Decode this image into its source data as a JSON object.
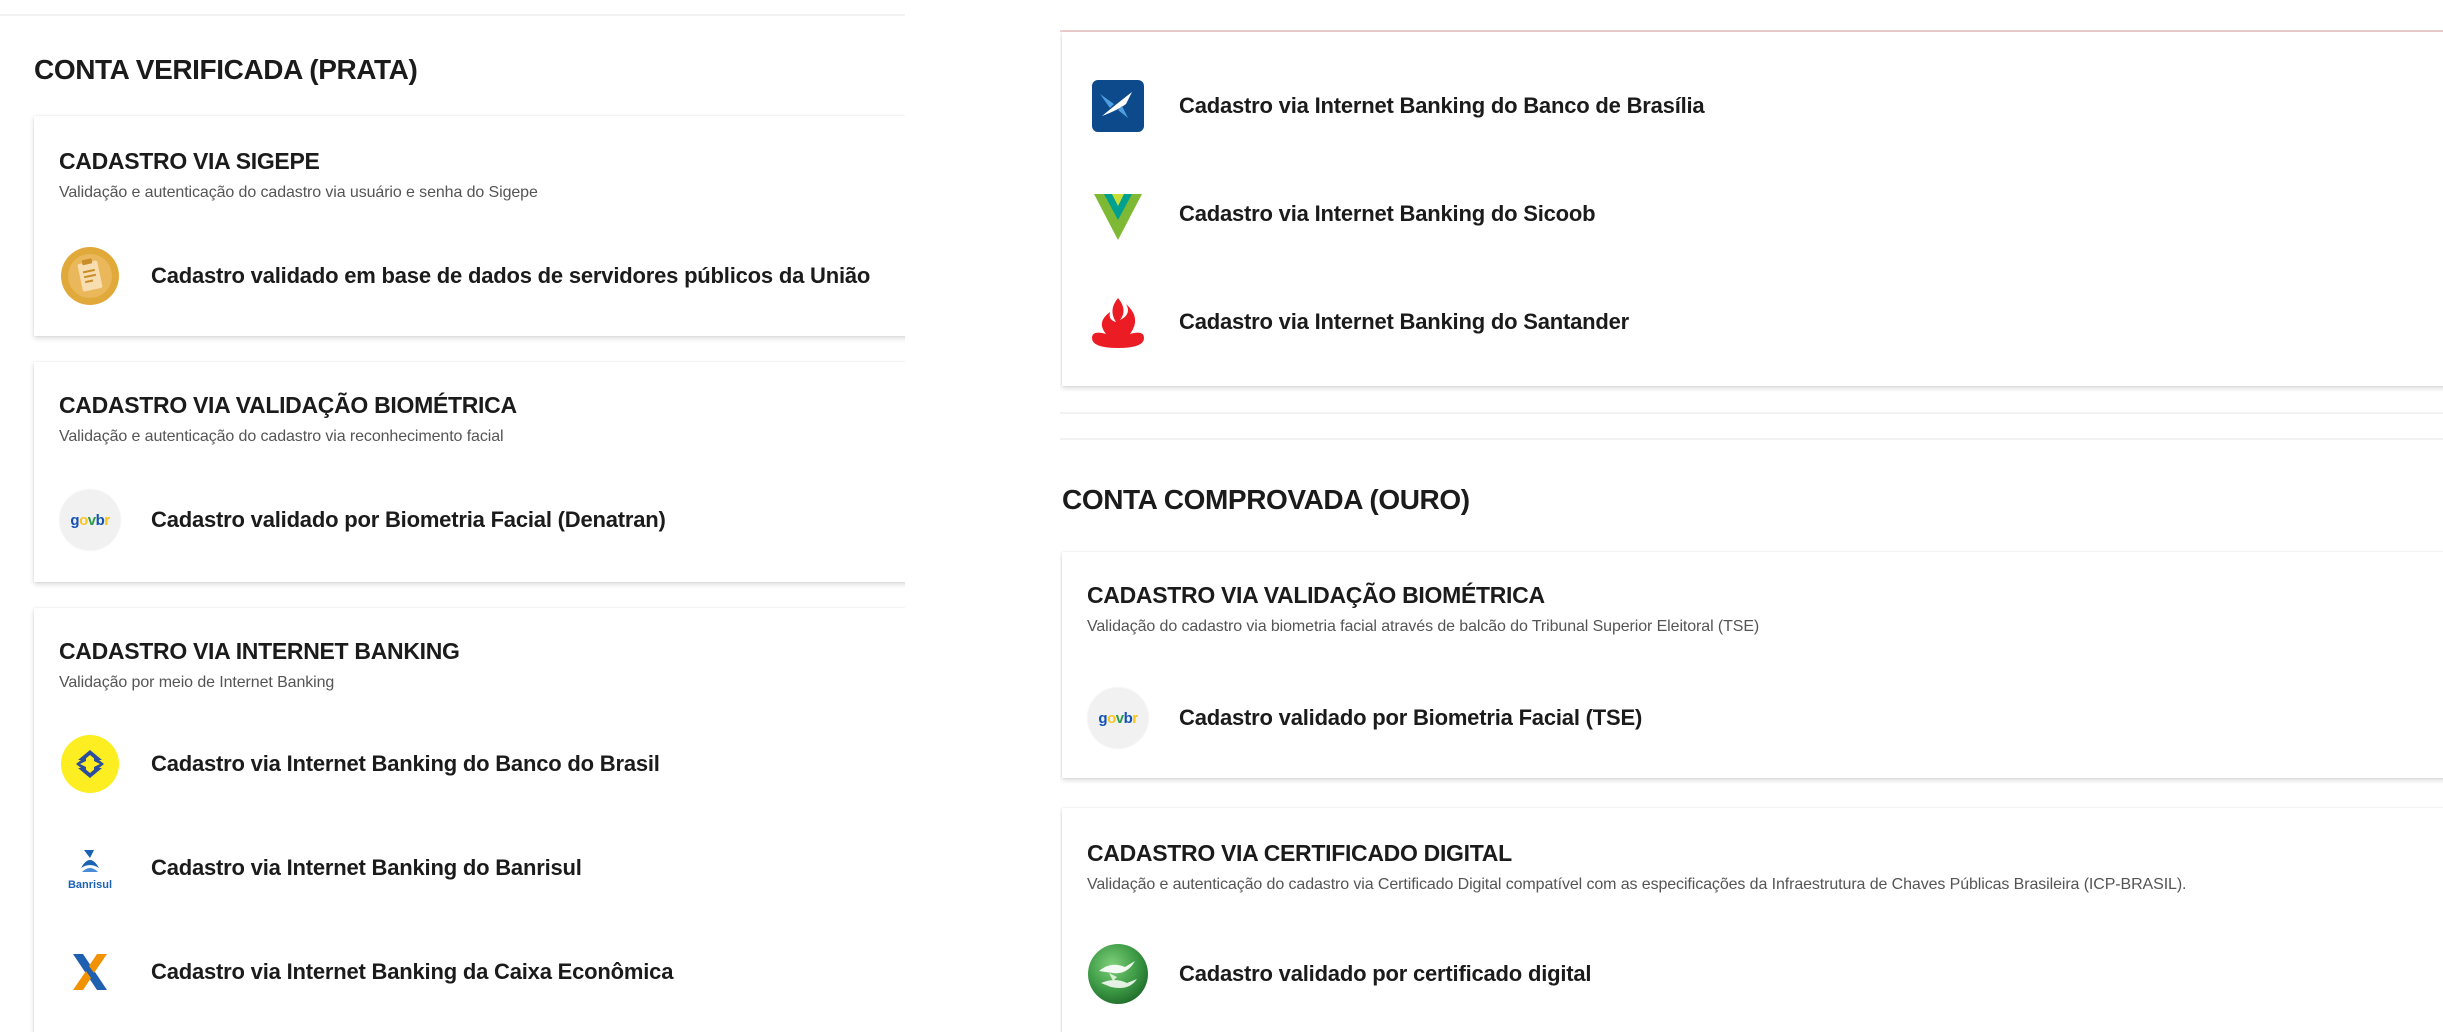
{
  "left": {
    "section_title": "CONTA VERIFICADA (PRATA)",
    "sigepe": {
      "title": "CADASTRO VIA SIGEPE",
      "description": "Validação e autenticação do cadastro via usuário e senha do Sigepe",
      "option": "Cadastro validado em base de dados de servidores públicos da União"
    },
    "biometria": {
      "title": "CADASTRO VIA VALIDAÇÃO BIOMÉTRICA",
      "description": "Validação e autenticação do cadastro via reconhecimento facial",
      "option": "Cadastro validado por Biometria Facial (Denatran)"
    },
    "internet_banking": {
      "title": "CADASTRO VIA INTERNET BANKING",
      "description": "Validação por meio de Internet Banking",
      "options": [
        "Cadastro via Internet Banking do Banco do Brasil",
        "Cadastro via Internet Banking do Banrisul",
        "Cadastro via Internet Banking da Caixa Econômica"
      ],
      "banrisul_logo_text": "Banrisul"
    }
  },
  "right": {
    "banking_options": [
      "Cadastro via Internet Banking do Banco de Brasília",
      "Cadastro via Internet Banking do Sicoob",
      "Cadastro via Internet Banking do Santander"
    ],
    "section_title": "CONTA COMPROVADA (OURO)",
    "biometria": {
      "title": "CADASTRO VIA VALIDAÇÃO BIOMÉTRICA",
      "description": "Validação do cadastro via biometria facial através de balcão do Tribunal Superior Eleitoral (TSE)",
      "option": "Cadastro validado por Biometria Facial (TSE)"
    },
    "certificado": {
      "title": "CADASTRO VIA CERTIFICADO DIGITAL",
      "description": "Validação e autenticação do cadastro via Certificado Digital compatível com as especificações da Infraestrutura de Chaves Públicas Brasileira (ICP-BRASIL).",
      "option": "Cadastro validado por certificado digital"
    }
  },
  "govbr_logo": {
    "g": "g",
    "o": "o",
    "v": "v",
    "b": "b",
    "r": "r"
  },
  "colors": {
    "gov_blue": "#1351b4",
    "gov_yellow": "#f9c51b",
    "gov_green": "#2e9a4a",
    "sigepe_gold": "#e0a93a",
    "bb_yellow": "#fcee21",
    "bb_blue": "#2b4c9f",
    "banrisul_blue": "#1b62b4",
    "caixa_blue": "#1f5fb0",
    "caixa_orange": "#f39200",
    "brb_blue": "#0c4a8c",
    "sicoob_green": "#7db934",
    "sicoob_teal": "#00a091",
    "santander_red": "#ec1c24",
    "cert_green": "#3d9a45"
  }
}
